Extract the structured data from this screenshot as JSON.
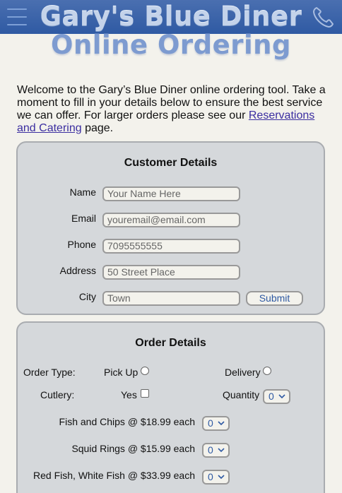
{
  "header": {
    "title_line1": "Gary's Blue Diner",
    "title_line2": "Online Ordering"
  },
  "intro": {
    "text_before": "Welcome to the Gary’s Blue Diner online ordering tool. Take a moment to fill in your details below to ensure the best service we can offer. For larger orders please see our ",
    "link_text": "Reservations and Catering",
    "text_after": " page."
  },
  "customer": {
    "heading": "Customer Details",
    "fields": [
      {
        "label": "Name",
        "placeholder": "Your Name Here"
      },
      {
        "label": "Email",
        "placeholder": "youremail@email.com"
      },
      {
        "label": "Phone",
        "placeholder": "7095555555"
      },
      {
        "label": "Address",
        "placeholder": "50 Street Place"
      },
      {
        "label": "City",
        "placeholder": "Town"
      }
    ],
    "submit_label": "Submit"
  },
  "order": {
    "heading": "Order Details",
    "order_type_label": "Order Type:",
    "pickup_label": "Pick Up",
    "delivery_label": "Delivery",
    "cutlery_label": "Cutlery:",
    "yes_label": "Yes",
    "quantity_label": "Quantity",
    "quantity_value": "0",
    "items": [
      {
        "label": "Fish and Chips @ $18.99 each",
        "qty": "0"
      },
      {
        "label": "Squid Rings @ $15.99 each",
        "qty": "0"
      },
      {
        "label": "Red Fish, White Fish @ $33.99 each",
        "qty": "0"
      }
    ]
  },
  "icons": {
    "menu": "hamburger-menu-icon",
    "phone": "phone-icon",
    "select_arrow": "chevron-down-icon"
  },
  "colors": {
    "header": "#2f5aa3",
    "accent": "#2f5aa3",
    "link": "#3b2ea0",
    "panel": "#d5d8db",
    "background": "#f3f2ec"
  }
}
